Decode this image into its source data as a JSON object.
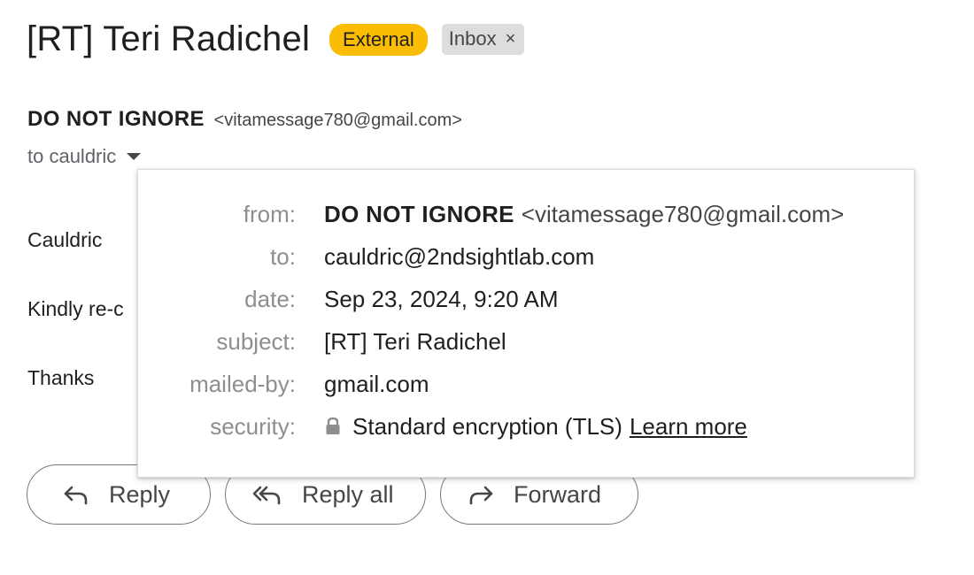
{
  "subject": "[RT] Teri Radichel",
  "labels": {
    "external": "External",
    "inbox": "Inbox",
    "remove_symbol": "×"
  },
  "sender": {
    "name": "DO NOT IGNORE",
    "email": "<vitamessage780@gmail.com>",
    "to_line": "to cauldric"
  },
  "body": {
    "greeting": "Cauldric",
    "line1": "Kindly re-c",
    "closing": "Thanks"
  },
  "actions": {
    "reply": "Reply",
    "reply_all": "Reply all",
    "forward": "Forward"
  },
  "details": {
    "from_key": "from:",
    "from_name": "DO NOT IGNORE",
    "from_email": "<vitamessage780@gmail.com>",
    "to_key": "to:",
    "to_val": "cauldric@2ndsightlab.com",
    "date_key": "date:",
    "date_val": "Sep 23, 2024, 9:20 AM",
    "subject_key": "subject:",
    "subject_val": "[RT] Teri Radichel",
    "mailed_by_key": "mailed-by:",
    "mailed_by_val": "gmail.com",
    "security_key": "security:",
    "security_val": "Standard encryption (TLS)",
    "learn_more": "Learn more"
  },
  "colors": {
    "external_badge": "#fbbc04",
    "inbox_badge": "#dddddd",
    "text": "#1f1f1f",
    "muted": "#8e8e8e"
  },
  "icons": [
    "lock-icon",
    "reply-icon",
    "reply-all-icon",
    "forward-icon",
    "chevron-down-icon",
    "close-icon"
  ]
}
